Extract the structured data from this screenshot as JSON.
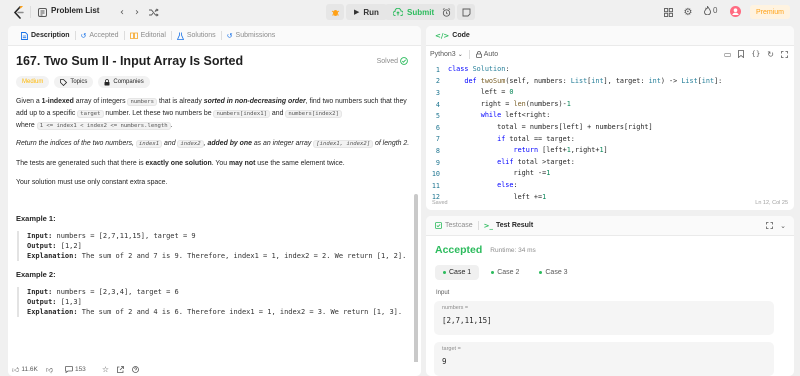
{
  "nav": {
    "problem_list": "Problem List",
    "run": "Run",
    "submit": "Submit",
    "fire_count": "0",
    "premium": "Premium"
  },
  "left_tabs": [
    {
      "label": "Description",
      "icon": "document-icon"
    },
    {
      "label": "Accepted",
      "icon": "history-icon"
    },
    {
      "label": "Editorial",
      "icon": "book-icon"
    },
    {
      "label": "Solutions",
      "icon": "flask-icon"
    },
    {
      "label": "Submissions",
      "icon": "history-icon"
    }
  ],
  "problem": {
    "title": "167. Two Sum II - Input Array Is Sorted",
    "status": "Solved",
    "difficulty": "Medium",
    "topics": "Topics",
    "companies": "Companies",
    "p1": {
      "a": "Given a ",
      "b": "1-indexed",
      "c": " array of integers ",
      "d": "numbers",
      "e": " that is already ",
      "f": "sorted in non-decreasing order",
      "g": ", find two numbers such that they add up to a specific ",
      "h": "target",
      "i": " number. Let these two numbers be ",
      "j": "numbers[index1]",
      "k": " and ",
      "l": "numbers[index2]",
      "m": " where ",
      "n": "1 <= index1 < index2 <= numbers.length",
      "o": "."
    },
    "p2": {
      "a": "Return the indices of the two numbers, ",
      "b": "index1",
      "c": " and ",
      "d": "index2",
      "e": ", ",
      "f": "added by one",
      "g": " as an integer array ",
      "h": "[index1, index2]",
      "i": " of length 2."
    },
    "p3": {
      "a": "The tests are generated such that there is ",
      "b": "exactly one solution",
      "c": ". You ",
      "d": "may not",
      "e": " use the same element twice."
    },
    "p4": "Your solution must use only constant extra space.",
    "examples": [
      {
        "title": "Example 1:",
        "input_label": "Input:",
        "input": " numbers = [2,7,11,15], target = 9",
        "output_label": "Output:",
        "output": " [1,2]",
        "expl_label": "Explanation:",
        "expl": " The sum of 2 and 7 is 9. Therefore, index1 = 1, index2 = 2. We return [1, 2]."
      },
      {
        "title": "Example 2:",
        "input_label": "Input:",
        "input": " numbers = [2,3,4], target = 6",
        "output_label": "Output:",
        "output": " [1,3]",
        "expl_label": "Explanation:",
        "expl": " The sum of 2 and 4 is 6. Therefore index1 = 1, index2 = 3. We return [1, 3]."
      }
    ]
  },
  "footer": {
    "likes": "11.6K",
    "comments": "153"
  },
  "code": {
    "tab": "Code",
    "language": "Python3",
    "auto": "Auto",
    "saved": "Saved",
    "cursor": "Ln 12, Col 25",
    "lines": [
      {
        "n": "1",
        "t": "class Solution:"
      },
      {
        "n": "2",
        "t": "    def twoSum(self, numbers: List[int], target: int) -> List[int]:"
      },
      {
        "n": "3",
        "t": "        left = 0"
      },
      {
        "n": "4",
        "t": "        right = len(numbers)-1"
      },
      {
        "n": "5",
        "t": "        while left<right:"
      },
      {
        "n": "6",
        "t": "            total = numbers[left] + numbers[right]"
      },
      {
        "n": "7",
        "t": "            if total == target:"
      },
      {
        "n": "8",
        "t": "                return [left+1,right+1]"
      },
      {
        "n": "9",
        "t": "            elif total >target:"
      },
      {
        "n": "10",
        "t": "                right -=1"
      },
      {
        "n": "11",
        "t": "            else:"
      },
      {
        "n": "12",
        "t": "                left +=1"
      }
    ]
  },
  "result": {
    "testcase_tab": "Testcase",
    "result_tab": "Test Result",
    "verdict": "Accepted",
    "runtime": "Runtime: 34 ms",
    "cases": [
      "Case 1",
      "Case 2",
      "Case 3"
    ],
    "input_label": "Input",
    "fields": [
      {
        "label": "numbers =",
        "value": "[2,7,11,15]"
      },
      {
        "label": "target =",
        "value": "9"
      }
    ]
  },
  "colors": {
    "accent_green": "#2cbb5d",
    "medium": "#ffb800",
    "premium": "#ffa116"
  }
}
